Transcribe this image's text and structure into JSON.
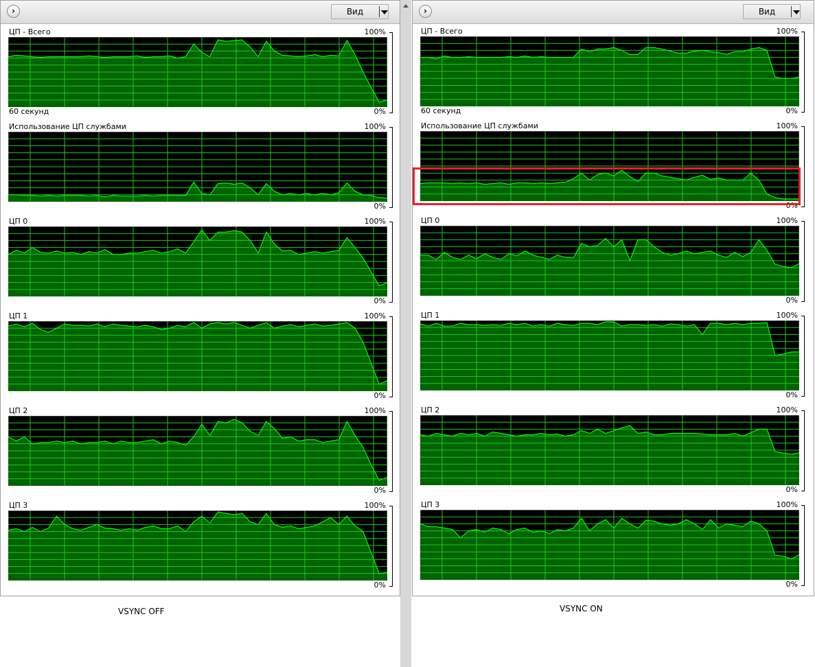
{
  "colors": {
    "fill": "#006400",
    "line": "#00ff00",
    "grid": "#1ec81e",
    "bg": "#000000",
    "highlight": "#e8202a"
  },
  "panels": [
    {
      "view_button": "Вид",
      "caption": "VSYNC OFF",
      "time_label": "60 секунд",
      "graphs": [
        {
          "title": "ЦП - Всего",
          "max_label": "100%",
          "min_label": "0%",
          "values": [
            72,
            74,
            73,
            72,
            71,
            72,
            72,
            72,
            72,
            72,
            73,
            72,
            71,
            72,
            72,
            72,
            73,
            71,
            72,
            72,
            73,
            70,
            72,
            90,
            78,
            72,
            96,
            94,
            95,
            96,
            86,
            72,
            94,
            80,
            74,
            73,
            72,
            73,
            75,
            72,
            74,
            73,
            95,
            75,
            50,
            28,
            7,
            10
          ]
        },
        {
          "title": "Использование ЦП службами",
          "max_label": "100%",
          "min_label": "0%",
          "values": [
            10,
            10,
            9,
            9,
            8,
            9,
            8,
            9,
            9,
            9,
            8,
            9,
            7,
            9,
            8,
            8,
            8,
            9,
            8,
            9,
            9,
            9,
            9,
            28,
            12,
            10,
            26,
            27,
            25,
            27,
            20,
            10,
            26,
            15,
            10,
            12,
            10,
            12,
            10,
            12,
            10,
            13,
            27,
            15,
            10,
            9,
            6,
            5
          ]
        },
        {
          "title": "ЦП 0",
          "max_label": "100%",
          "min_label": "0%",
          "values": [
            60,
            66,
            62,
            70,
            63,
            62,
            65,
            62,
            63,
            60,
            64,
            62,
            67,
            60,
            60,
            62,
            62,
            64,
            66,
            62,
            64,
            68,
            62,
            78,
            95,
            80,
            92,
            92,
            94,
            92,
            80,
            62,
            92,
            75,
            65,
            66,
            60,
            62,
            64,
            62,
            64,
            66,
            84,
            70,
            55,
            35,
            15,
            20
          ]
        },
        {
          "title": "ЦП 1",
          "max_label": "100%",
          "min_label": "0%",
          "values": [
            93,
            96,
            92,
            97,
            88,
            84,
            90,
            96,
            94,
            94,
            93,
            96,
            92,
            96,
            94,
            93,
            92,
            94,
            92,
            88,
            90,
            94,
            92,
            98,
            90,
            96,
            98,
            96,
            98,
            94,
            90,
            94,
            98,
            90,
            93,
            95,
            92,
            94,
            96,
            93,
            94,
            96,
            98,
            90,
            70,
            40,
            10,
            15
          ]
        },
        {
          "title": "ЦП 2",
          "max_label": "100%",
          "min_label": "0%",
          "values": [
            70,
            64,
            70,
            60,
            62,
            62,
            64,
            62,
            64,
            60,
            62,
            62,
            64,
            60,
            64,
            62,
            62,
            64,
            66,
            60,
            64,
            62,
            58,
            70,
            88,
            72,
            92,
            90,
            95,
            90,
            78,
            72,
            92,
            82,
            68,
            70,
            64,
            66,
            66,
            62,
            64,
            66,
            92,
            72,
            55,
            30,
            8,
            12
          ]
        },
        {
          "title": "ЦП 3",
          "max_label": "100%",
          "min_label": "0%",
          "values": [
            72,
            74,
            70,
            76,
            70,
            75,
            92,
            80,
            74,
            72,
            76,
            80,
            75,
            74,
            72,
            74,
            72,
            76,
            78,
            74,
            74,
            78,
            70,
            84,
            92,
            82,
            98,
            96,
            94,
            96,
            84,
            80,
            96,
            80,
            76,
            78,
            74,
            76,
            78,
            84,
            90,
            80,
            92,
            78,
            70,
            40,
            10,
            12
          ]
        }
      ]
    },
    {
      "view_button": "Вид",
      "caption": "VSYNC ON",
      "time_label": "60 секунд",
      "graphs": [
        {
          "title": "ЦП - Всего",
          "max_label": "100%",
          "min_label": "0%",
          "values": [
            70,
            70,
            68,
            72,
            70,
            70,
            71,
            70,
            70,
            70,
            70,
            71,
            70,
            72,
            70,
            71,
            70,
            70,
            70,
            70,
            82,
            78,
            82,
            82,
            84,
            80,
            74,
            74,
            84,
            84,
            82,
            79,
            76,
            76,
            79,
            80,
            78,
            77,
            74,
            78,
            78,
            82,
            84,
            80,
            42,
            40,
            40,
            42
          ]
        },
        {
          "title": "Использование ЦП службами",
          "max_label": "100%",
          "min_label": "0%",
          "values": [
            25,
            26,
            26,
            26,
            25,
            26,
            25,
            26,
            24,
            25,
            26,
            24,
            26,
            26,
            25,
            26,
            25,
            26,
            27,
            32,
            40,
            30,
            38,
            40,
            36,
            44,
            35,
            28,
            40,
            40,
            36,
            34,
            32,
            30,
            34,
            37,
            31,
            33,
            30,
            30,
            30,
            40,
            30,
            10,
            5,
            3,
            3,
            3
          ]
        },
        {
          "title": "ЦП 0",
          "max_label": "100%",
          "min_label": "0%",
          "values": [
            58,
            58,
            52,
            62,
            55,
            52,
            58,
            53,
            60,
            55,
            52,
            60,
            57,
            64,
            58,
            55,
            52,
            58,
            55,
            54,
            75,
            70,
            72,
            82,
            70,
            80,
            50,
            80,
            80,
            70,
            62,
            58,
            60,
            64,
            60,
            62,
            64,
            58,
            55,
            62,
            56,
            62,
            80,
            65,
            45,
            42,
            40,
            46
          ]
        },
        {
          "title": "ЦП 1",
          "max_label": "100%",
          "min_label": "0%",
          "values": [
            95,
            92,
            96,
            92,
            92,
            96,
            94,
            94,
            93,
            94,
            93,
            96,
            94,
            96,
            92,
            94,
            92,
            96,
            94,
            93,
            96,
            96,
            94,
            98,
            98,
            92,
            94,
            94,
            93,
            94,
            92,
            95,
            94,
            92,
            94,
            80,
            96,
            96,
            94,
            96,
            94,
            96,
            96,
            97,
            50,
            52,
            55,
            55
          ]
        },
        {
          "title": "ЦП 2",
          "max_label": "100%",
          "min_label": "0%",
          "values": [
            72,
            70,
            74,
            72,
            70,
            74,
            72,
            74,
            70,
            76,
            74,
            72,
            70,
            72,
            72,
            74,
            72,
            73,
            70,
            72,
            78,
            74,
            80,
            74,
            78,
            82,
            85,
            74,
            76,
            72,
            72,
            74,
            74,
            74,
            74,
            73,
            72,
            72,
            72,
            74,
            70,
            75,
            80,
            80,
            48,
            46,
            44,
            46
          ]
        },
        {
          "title": "ЦП 3",
          "max_label": "100%",
          "min_label": "0%",
          "values": [
            80,
            76,
            76,
            74,
            72,
            60,
            70,
            72,
            68,
            74,
            72,
            66,
            72,
            74,
            68,
            70,
            66,
            72,
            70,
            74,
            88,
            70,
            80,
            86,
            74,
            88,
            80,
            74,
            85,
            84,
            80,
            78,
            80,
            86,
            80,
            72,
            86,
            74,
            80,
            78,
            76,
            84,
            80,
            70,
            35,
            34,
            30,
            36
          ]
        }
      ]
    }
  ]
}
